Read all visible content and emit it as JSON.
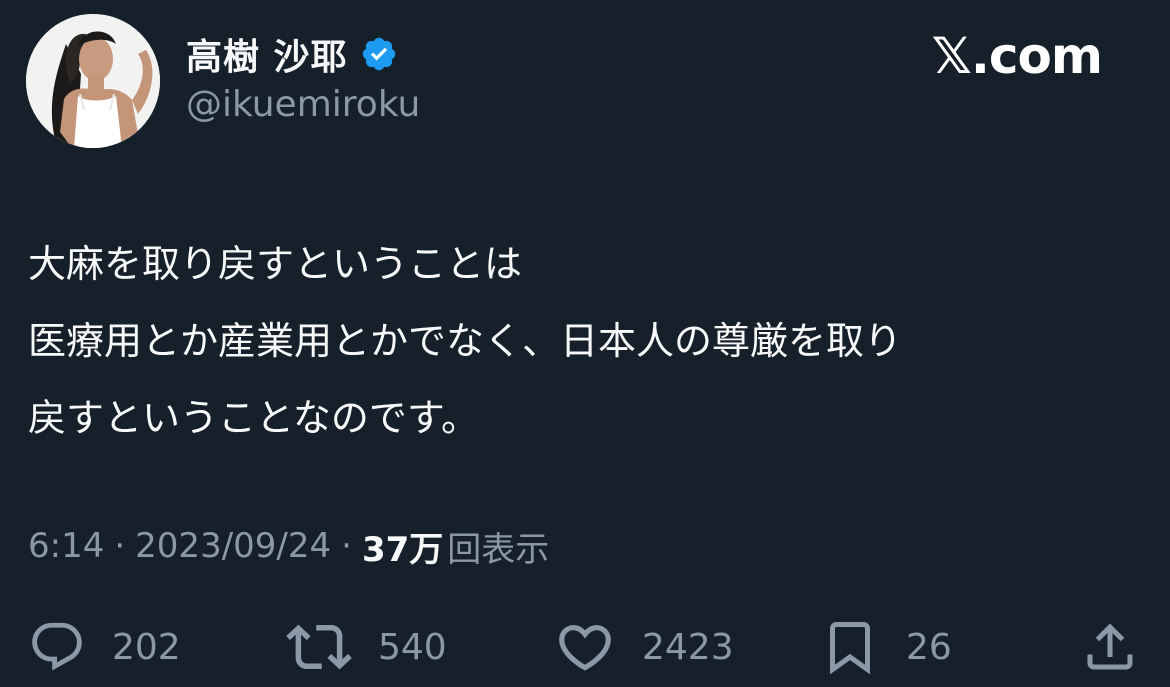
{
  "author": {
    "display_name": "高樹 沙耶",
    "handle": "@ikuemiroku",
    "verified_icon": "verified-badge-icon",
    "avatar_icon": "profile-photo"
  },
  "brand": {
    "logo_letter": "𝕏",
    "label": ".com"
  },
  "tweet": {
    "lines": [
      "大麻を取り戻すということは",
      "医療用とか産業用とかでなく、日本人の尊厳を取り",
      "戻すということなのです。"
    ]
  },
  "meta": {
    "time": "6:14",
    "separator": "·",
    "date": "2023/09/24",
    "views_count": "37万",
    "views_label": "回表示"
  },
  "actions": {
    "replies": {
      "icon": "reply-icon",
      "count": "202"
    },
    "retweets": {
      "icon": "retweet-icon",
      "count": "540"
    },
    "likes": {
      "icon": "heart-icon",
      "count": "2423"
    },
    "bookmarks": {
      "icon": "bookmark-icon",
      "count": "26"
    },
    "share": {
      "icon": "share-icon"
    }
  },
  "colors": {
    "background": "#15202b",
    "primary_text": "#f7f9f9",
    "secondary_text": "#8b98a5",
    "verified": "#1d9bf0"
  }
}
